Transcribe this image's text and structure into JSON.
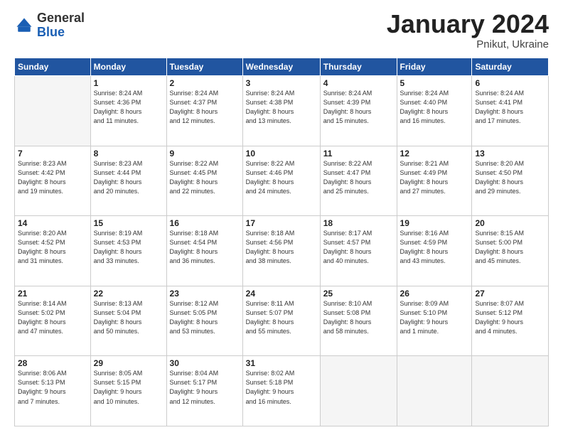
{
  "header": {
    "logo_general": "General",
    "logo_blue": "Blue",
    "title": "January 2024",
    "location": "Pnikut, Ukraine"
  },
  "days_of_week": [
    "Sunday",
    "Monday",
    "Tuesday",
    "Wednesday",
    "Thursday",
    "Friday",
    "Saturday"
  ],
  "weeks": [
    [
      {
        "day": "",
        "info": ""
      },
      {
        "day": "1",
        "info": "Sunrise: 8:24 AM\nSunset: 4:36 PM\nDaylight: 8 hours\nand 11 minutes."
      },
      {
        "day": "2",
        "info": "Sunrise: 8:24 AM\nSunset: 4:37 PM\nDaylight: 8 hours\nand 12 minutes."
      },
      {
        "day": "3",
        "info": "Sunrise: 8:24 AM\nSunset: 4:38 PM\nDaylight: 8 hours\nand 13 minutes."
      },
      {
        "day": "4",
        "info": "Sunrise: 8:24 AM\nSunset: 4:39 PM\nDaylight: 8 hours\nand 15 minutes."
      },
      {
        "day": "5",
        "info": "Sunrise: 8:24 AM\nSunset: 4:40 PM\nDaylight: 8 hours\nand 16 minutes."
      },
      {
        "day": "6",
        "info": "Sunrise: 8:24 AM\nSunset: 4:41 PM\nDaylight: 8 hours\nand 17 minutes."
      }
    ],
    [
      {
        "day": "7",
        "info": "Sunrise: 8:23 AM\nSunset: 4:42 PM\nDaylight: 8 hours\nand 19 minutes."
      },
      {
        "day": "8",
        "info": "Sunrise: 8:23 AM\nSunset: 4:44 PM\nDaylight: 8 hours\nand 20 minutes."
      },
      {
        "day": "9",
        "info": "Sunrise: 8:22 AM\nSunset: 4:45 PM\nDaylight: 8 hours\nand 22 minutes."
      },
      {
        "day": "10",
        "info": "Sunrise: 8:22 AM\nSunset: 4:46 PM\nDaylight: 8 hours\nand 24 minutes."
      },
      {
        "day": "11",
        "info": "Sunrise: 8:22 AM\nSunset: 4:47 PM\nDaylight: 8 hours\nand 25 minutes."
      },
      {
        "day": "12",
        "info": "Sunrise: 8:21 AM\nSunset: 4:49 PM\nDaylight: 8 hours\nand 27 minutes."
      },
      {
        "day": "13",
        "info": "Sunrise: 8:20 AM\nSunset: 4:50 PM\nDaylight: 8 hours\nand 29 minutes."
      }
    ],
    [
      {
        "day": "14",
        "info": "Sunrise: 8:20 AM\nSunset: 4:52 PM\nDaylight: 8 hours\nand 31 minutes."
      },
      {
        "day": "15",
        "info": "Sunrise: 8:19 AM\nSunset: 4:53 PM\nDaylight: 8 hours\nand 33 minutes."
      },
      {
        "day": "16",
        "info": "Sunrise: 8:18 AM\nSunset: 4:54 PM\nDaylight: 8 hours\nand 36 minutes."
      },
      {
        "day": "17",
        "info": "Sunrise: 8:18 AM\nSunset: 4:56 PM\nDaylight: 8 hours\nand 38 minutes."
      },
      {
        "day": "18",
        "info": "Sunrise: 8:17 AM\nSunset: 4:57 PM\nDaylight: 8 hours\nand 40 minutes."
      },
      {
        "day": "19",
        "info": "Sunrise: 8:16 AM\nSunset: 4:59 PM\nDaylight: 8 hours\nand 43 minutes."
      },
      {
        "day": "20",
        "info": "Sunrise: 8:15 AM\nSunset: 5:00 PM\nDaylight: 8 hours\nand 45 minutes."
      }
    ],
    [
      {
        "day": "21",
        "info": "Sunrise: 8:14 AM\nSunset: 5:02 PM\nDaylight: 8 hours\nand 47 minutes."
      },
      {
        "day": "22",
        "info": "Sunrise: 8:13 AM\nSunset: 5:04 PM\nDaylight: 8 hours\nand 50 minutes."
      },
      {
        "day": "23",
        "info": "Sunrise: 8:12 AM\nSunset: 5:05 PM\nDaylight: 8 hours\nand 53 minutes."
      },
      {
        "day": "24",
        "info": "Sunrise: 8:11 AM\nSunset: 5:07 PM\nDaylight: 8 hours\nand 55 minutes."
      },
      {
        "day": "25",
        "info": "Sunrise: 8:10 AM\nSunset: 5:08 PM\nDaylight: 8 hours\nand 58 minutes."
      },
      {
        "day": "26",
        "info": "Sunrise: 8:09 AM\nSunset: 5:10 PM\nDaylight: 9 hours\nand 1 minute."
      },
      {
        "day": "27",
        "info": "Sunrise: 8:07 AM\nSunset: 5:12 PM\nDaylight: 9 hours\nand 4 minutes."
      }
    ],
    [
      {
        "day": "28",
        "info": "Sunrise: 8:06 AM\nSunset: 5:13 PM\nDaylight: 9 hours\nand 7 minutes."
      },
      {
        "day": "29",
        "info": "Sunrise: 8:05 AM\nSunset: 5:15 PM\nDaylight: 9 hours\nand 10 minutes."
      },
      {
        "day": "30",
        "info": "Sunrise: 8:04 AM\nSunset: 5:17 PM\nDaylight: 9 hours\nand 12 minutes."
      },
      {
        "day": "31",
        "info": "Sunrise: 8:02 AM\nSunset: 5:18 PM\nDaylight: 9 hours\nand 16 minutes."
      },
      {
        "day": "",
        "info": ""
      },
      {
        "day": "",
        "info": ""
      },
      {
        "day": "",
        "info": ""
      }
    ]
  ]
}
